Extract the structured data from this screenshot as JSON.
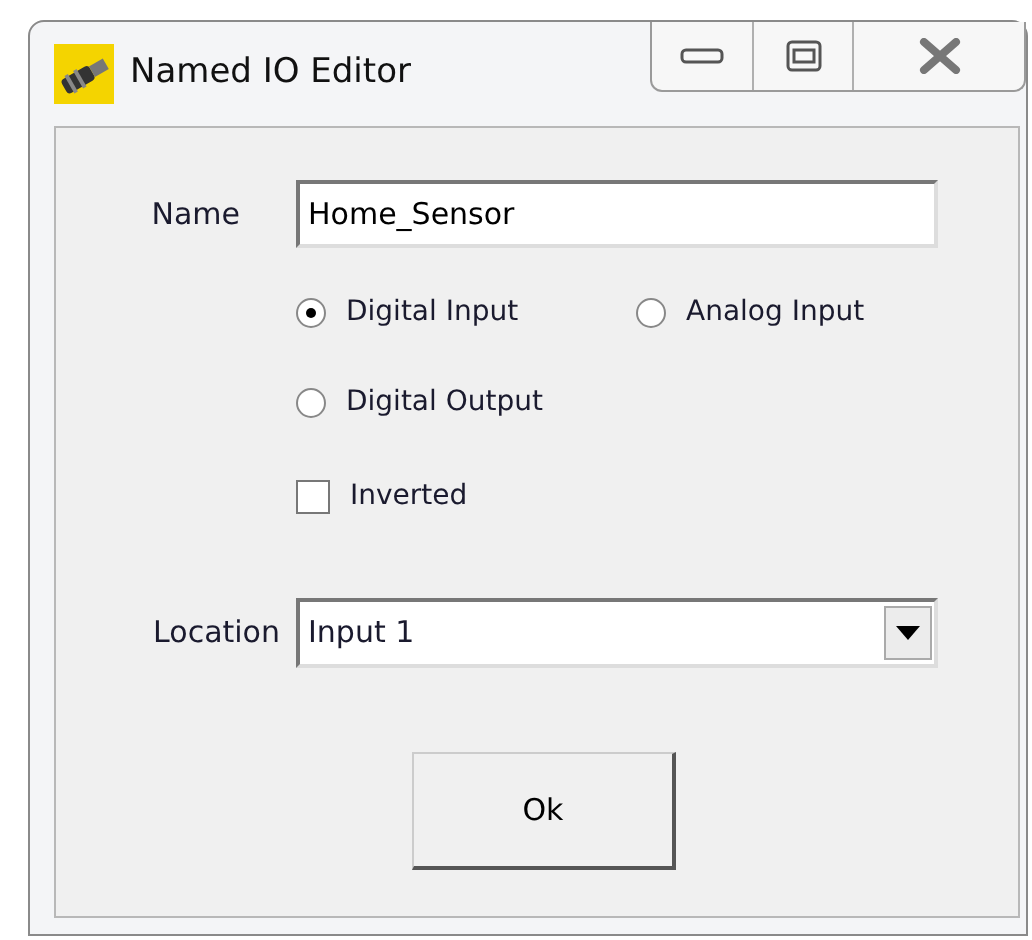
{
  "window": {
    "title": "Named IO Editor"
  },
  "name": {
    "label": "Name",
    "value": "Home_Sensor"
  },
  "io_types": [
    {
      "label": "Digital Input",
      "selected": true
    },
    {
      "label": "Analog Input",
      "selected": false
    },
    {
      "label": "Digital Output",
      "selected": false
    }
  ],
  "inverted": {
    "label": "Inverted",
    "checked": false
  },
  "location": {
    "label": "Location",
    "value": "Input 1"
  },
  "buttons": [
    "Ok"
  ]
}
